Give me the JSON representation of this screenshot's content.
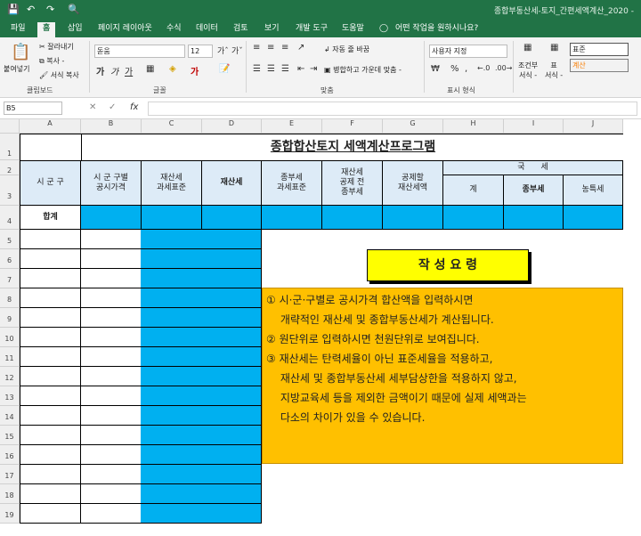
{
  "titlebar": {
    "save_icon": "save-icon",
    "undo_icon": "undo-icon",
    "redo_icon": "redo-icon",
    "preview_icon": "print-preview-icon",
    "document_title": "종합부동산세-토지_간편세액계산_2020 -"
  },
  "tabs": [
    "파일",
    "홈",
    "삽입",
    "페이지 레이아웃",
    "수식",
    "데이터",
    "검토",
    "보기",
    "개발 도구",
    "도움말"
  ],
  "tell_me": "어떤 작업을 원하시나요?",
  "ribbon": {
    "paste": "붙여넣기",
    "cut": "잘라내기",
    "copy": "복사 -",
    "format_painter": "서식 복사",
    "clipboard_label": "클립보드",
    "font_name": "돋움",
    "font_size": "12",
    "font_label": "글꼴",
    "wrap_text": "자동 줄 바꿈",
    "merge_center": "병합하고 가운데 맞춤 -",
    "alignment_label": "맞춤",
    "number_format": "사용자 지정",
    "number_label": "표시 형식",
    "cond_format": "조건부\n서식 -",
    "table_format": "표\n서식 -",
    "style_normal": "표준",
    "style_calc": "계산"
  },
  "formula_bar": {
    "name_box": "B5",
    "fx": "fx",
    "value": ""
  },
  "columns": [
    "A",
    "B",
    "C",
    "D",
    "E",
    "F",
    "G",
    "H",
    "I",
    "J"
  ],
  "rows": [
    "1",
    "2",
    "3",
    "4",
    "5",
    "6",
    "7",
    "8",
    "9",
    "10",
    "11",
    "12",
    "13",
    "14",
    "15",
    "16",
    "17",
    "18",
    "19"
  ],
  "sheet": {
    "title": "종합합산토지 세액계산프로그램",
    "headers": {
      "sigungu": "시 군 구",
      "public_price": "시 군 구별\n공시가격",
      "prop_tax_base": "재산세\n과세표준",
      "prop_tax": "재산세",
      "comp_tax_base": "종부세\n과세표준",
      "prop_tax_before_deduct": "재산세\n공제 전\n종부세",
      "deduct_prop_tax": "공제할\n재산세액",
      "national_tax": "국　　세",
      "total": "계",
      "comp_tax": "종부세",
      "rural_tax": "농특세"
    },
    "total_label": "합계"
  },
  "notes": {
    "title": "작 성 요 령",
    "lines": [
      "① 시·군·구별로 공시가격 합산액을 입력하시면",
      "　 개략적인 재산세 및 종합부동산세가 계산됩니다.",
      "② 원단위로 입력하시면 천원단위로 보여집니다.",
      "③ 재산세는 탄력세율이 아닌 표준세율을 적용하고,",
      "　 재산세 및 종합부동산세 세부담상한을 적용하지 않고,",
      "　 지방교육세 등을 제외한 금액이기 때문에 실제 세액과는",
      "　 다소의 차이가 있을 수 있습니다."
    ]
  },
  "colors": {
    "excel_green": "#217346",
    "cyan": "#00b0f0",
    "header_blue": "#ddebf7",
    "notes_orange": "#ffc000",
    "notes_title_yellow": "#ffff00"
  }
}
